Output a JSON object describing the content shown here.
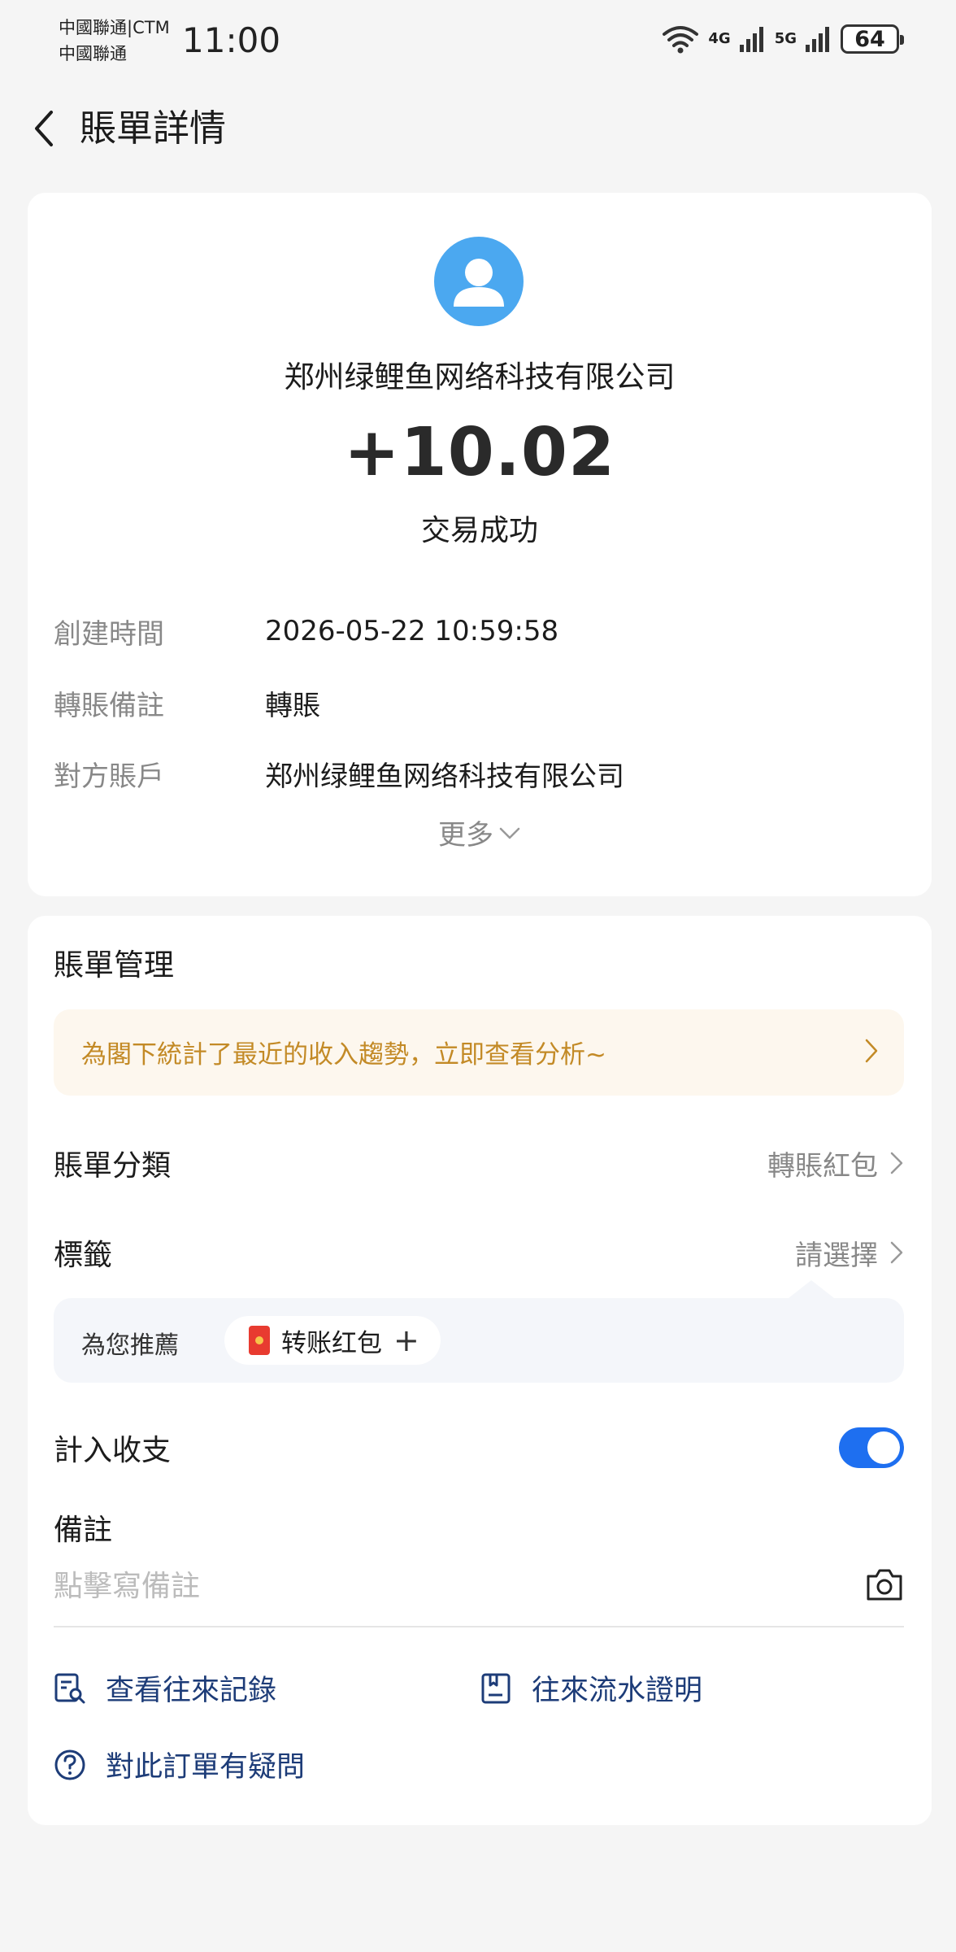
{
  "status_bar": {
    "carrier_1": "中國聯通|CTM",
    "carrier_2": "中國聯通",
    "time": "11:00",
    "signal_1": "4G",
    "signal_2": "5G",
    "battery": "64"
  },
  "header": {
    "title": "賬單詳情"
  },
  "transaction": {
    "merchant": "郑州绿鲤鱼网络科技有限公司",
    "amount": "+10.02",
    "status": "交易成功",
    "details": [
      {
        "label": "創建時間",
        "value": "2026-05-22 10:59:58"
      },
      {
        "label": "轉賬備註",
        "value": "轉賬"
      },
      {
        "label": "對方賬戶",
        "value": "郑州绿鲤鱼网络科技有限公司"
      }
    ],
    "more_label": "更多"
  },
  "management": {
    "title": "賬單管理",
    "promo_text": "為閣下統計了最近的收入趨勢，立即查看分析~",
    "category_label": "賬單分類",
    "category_value": "轉賬紅包",
    "tag_label": "標籤",
    "tag_value": "請選擇",
    "recommend_label": "為您推薦",
    "recommend_chip": "转账红包",
    "include_label": "計入收支",
    "include_enabled": true,
    "memo_label": "備註",
    "memo_placeholder": "點擊寫備註",
    "links": {
      "history": "查看往來記錄",
      "statement": "往來流水證明",
      "question": "對此訂單有疑問"
    }
  },
  "colors": {
    "accent_blue": "#1e6ff0",
    "avatar_blue": "#4ba8f0",
    "promo_text": "#c38a26",
    "link_text": "#1d3c78"
  }
}
